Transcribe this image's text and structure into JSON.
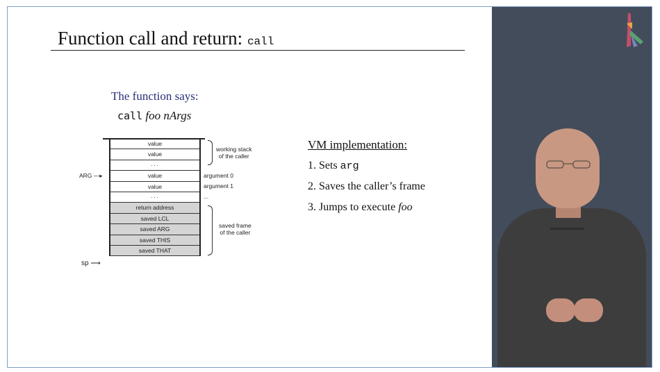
{
  "slide": {
    "title": "Function call and return: ",
    "title_code": "call",
    "says_heading": "The function says:",
    "call_keyword": "call",
    "call_args": "foo nArgs"
  },
  "stack": {
    "cells": [
      "value",
      "value",
      "···",
      "value",
      "value",
      "···",
      "return address",
      "saved LCL",
      "saved ARG",
      "saved THIS",
      "saved THAT"
    ],
    "arg_label": "ARG",
    "sp_label": "sp",
    "working_stack_label_1": "working stack",
    "working_stack_label_2": "of the caller",
    "argument0_label": "argument 0",
    "argument1_label": "argument 1",
    "arg_dots": "...",
    "saved_frame_label_1": "saved frame",
    "saved_frame_label_2": "of the caller"
  },
  "vm": {
    "heading": "VM implementation:",
    "step1_prefix": "1. Sets ",
    "step1_code": "arg",
    "step2": "2. Saves the caller’s frame",
    "step3_prefix": "3. Jumps to execute ",
    "step3_italic": "foo"
  },
  "colors": {
    "heading_blue": "#27307a",
    "presenter_bg": "#434c5b",
    "saved_cell_grey": "#d4d4d4"
  },
  "icons": [
    "logo-icon",
    "arrow-right-icon"
  ]
}
